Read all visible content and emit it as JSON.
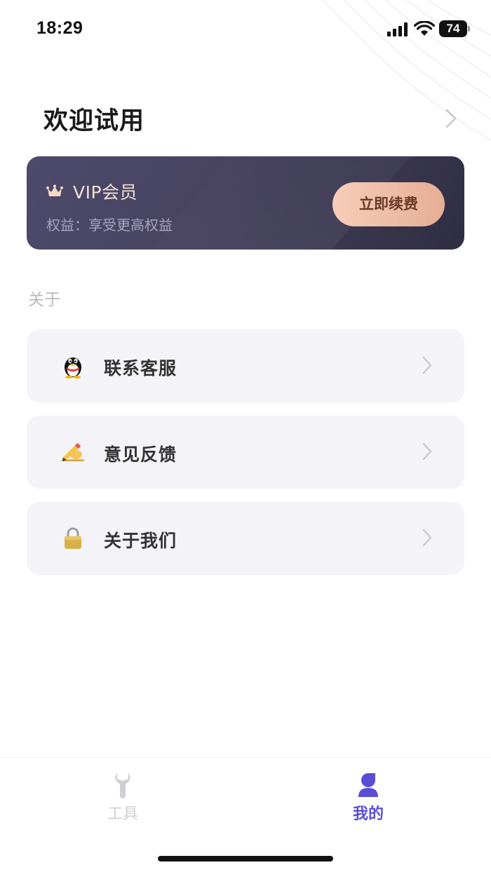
{
  "status_bar": {
    "time": "18:29",
    "battery": "74"
  },
  "header": {
    "welcome": "欢迎试用"
  },
  "vip": {
    "title": "VIP会员",
    "subtitle": "权益：享受更高权益",
    "renew_label": "立即续费",
    "icon": "crown-icon"
  },
  "about": {
    "section_label": "关于",
    "items": [
      {
        "label": "联系客服",
        "icon": "penguin-icon"
      },
      {
        "label": "意见反馈",
        "icon": "writing-hand-icon"
      },
      {
        "label": "关于我们",
        "icon": "lock-icon"
      }
    ]
  },
  "tab_bar": {
    "tabs": [
      {
        "label": "工具",
        "icon": "wrench-icon",
        "active": false
      },
      {
        "label": "我的",
        "icon": "person-icon",
        "active": true
      }
    ]
  },
  "colors": {
    "accent": "#5a4fd4",
    "vip_card": "#46425f",
    "renew_button": "#f0c3ad",
    "menu_bg": "#f3f3f8"
  }
}
